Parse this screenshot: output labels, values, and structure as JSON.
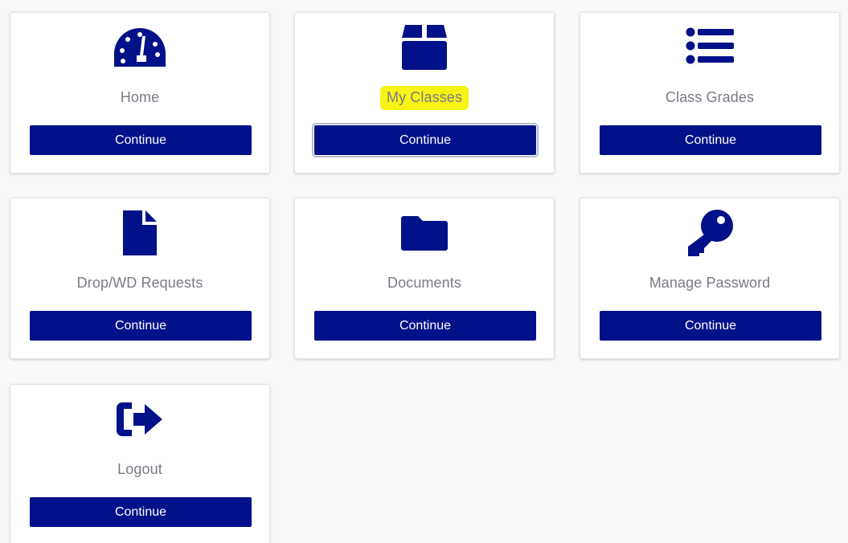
{
  "colors": {
    "accent": "#001189",
    "label": "#7a7a84",
    "highlight": "#f6f315"
  },
  "cards": [
    {
      "label": "Home",
      "button": "Continue",
      "icon": "dashboard-icon",
      "highlighted": false
    },
    {
      "label": "My Classes",
      "button": "Continue",
      "icon": "box-icon",
      "highlighted": true
    },
    {
      "label": "Class Grades",
      "button": "Continue",
      "icon": "list-icon",
      "highlighted": false
    },
    {
      "label": "Drop/WD Requests",
      "button": "Continue",
      "icon": "file-icon",
      "highlighted": false
    },
    {
      "label": "Documents",
      "button": "Continue",
      "icon": "folder-icon",
      "highlighted": false
    },
    {
      "label": "Manage Password",
      "button": "Continue",
      "icon": "key-icon",
      "highlighted": false
    },
    {
      "label": "Logout",
      "button": "Continue",
      "icon": "logout-icon",
      "highlighted": false
    }
  ]
}
